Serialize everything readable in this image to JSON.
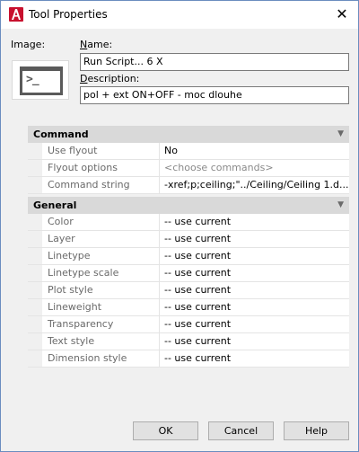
{
  "window": {
    "title": "Tool Properties",
    "close_glyph": "✕",
    "app_icon": "autocad-a-icon"
  },
  "image_label": "Image:",
  "preview_icon": "run-script-icon",
  "preview_glyph": ">_",
  "name": {
    "label_first": "N",
    "label_rest": "ame:",
    "value": "Run Script... 6 X"
  },
  "description": {
    "label_first": "D",
    "label_rest": "escription:",
    "value": "pol + ext ON+OFF - moc dlouhe"
  },
  "categories": [
    {
      "title": "Command",
      "rows": [
        {
          "name": "Use flyout",
          "value": "No"
        },
        {
          "name": "Flyout options",
          "value": "<choose commands>"
        },
        {
          "name": "Command string",
          "value": "-xref;p;ceiling;\"../Ceiling/Ceiling 1.d..."
        }
      ]
    },
    {
      "title": "General",
      "rows": [
        {
          "name": "Color",
          "value": "-- use current"
        },
        {
          "name": "Layer",
          "value": "-- use current"
        },
        {
          "name": "Linetype",
          "value": "-- use current"
        },
        {
          "name": "Linetype scale",
          "value": "-- use current"
        },
        {
          "name": "Plot style",
          "value": "-- use current"
        },
        {
          "name": "Lineweight",
          "value": "-- use current"
        },
        {
          "name": "Transparency",
          "value": "-- use current"
        },
        {
          "name": "Text style",
          "value": "-- use current"
        },
        {
          "name": "Dimension  style",
          "value": "-- use current"
        }
      ]
    }
  ],
  "collapse_glyph": "▼",
  "buttons": {
    "ok": "OK",
    "cancel": "Cancel",
    "help": "Help"
  },
  "colors": {
    "app_icon_red": "#c8102e",
    "category_header": "#d9d9d9",
    "window_border": "#6b8dbf"
  }
}
